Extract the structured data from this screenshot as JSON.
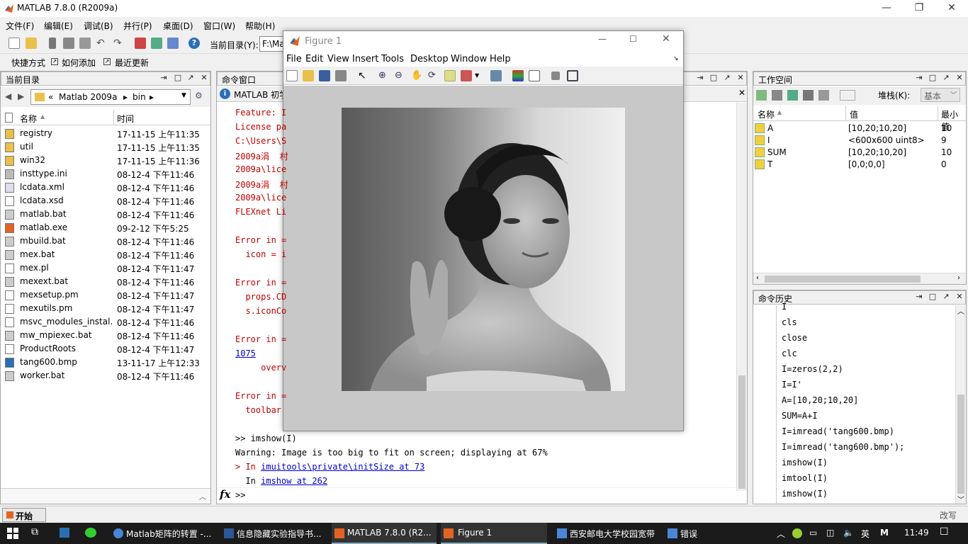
{
  "app": {
    "title": "MATLAB  7.8.0 (R2009a)",
    "menu": [
      "文件(F)",
      "编辑(E)",
      "调试(B)",
      "并行(P)",
      "桌面(D)",
      "窗口(W)",
      "帮助(H)"
    ],
    "current_dir_label": "当前目录(Y):",
    "current_dir_value": "F:\\Ma",
    "shortcuts": [
      "快捷方式",
      "如何添加",
      "最近更新"
    ]
  },
  "current_folder": {
    "title": "当前目录",
    "path_parts": [
      "«",
      "Matlab 2009a",
      "▸",
      "bin",
      "▸"
    ],
    "col_name": "名称",
    "col_time": "时间",
    "files": [
      {
        "name": "registry",
        "time": "17-11-15 上午11:35",
        "type": "folder"
      },
      {
        "name": "util",
        "time": "17-11-15 上午11:35",
        "type": "folder"
      },
      {
        "name": "win32",
        "time": "17-11-15 上午11:36",
        "type": "folder"
      },
      {
        "name": "insttype.ini",
        "time": "08-12-4 下午11:46",
        "type": "ini"
      },
      {
        "name": "lcdata.xml",
        "time": "08-12-4 下午11:46",
        "type": "xml"
      },
      {
        "name": "lcdata.xsd",
        "time": "08-12-4 下午11:46",
        "type": "file"
      },
      {
        "name": "matlab.bat",
        "time": "08-12-4 下午11:46",
        "type": "bat"
      },
      {
        "name": "matlab.exe",
        "time": "09-2-12 下午5:25",
        "type": "exe"
      },
      {
        "name": "mbuild.bat",
        "time": "08-12-4 下午11:46",
        "type": "bat"
      },
      {
        "name": "mex.bat",
        "time": "08-12-4 下午11:46",
        "type": "bat"
      },
      {
        "name": "mex.pl",
        "time": "08-12-4 下午11:47",
        "type": "file"
      },
      {
        "name": "mexext.bat",
        "time": "08-12-4 下午11:46",
        "type": "bat"
      },
      {
        "name": "mexsetup.pm",
        "time": "08-12-4 下午11:47",
        "type": "file"
      },
      {
        "name": "mexutils.pm",
        "time": "08-12-4 下午11:47",
        "type": "file"
      },
      {
        "name": "msvc_modules_instal...",
        "time": "08-12-4 下午11:46",
        "type": "file"
      },
      {
        "name": "mw_mpiexec.bat",
        "time": "08-12-4 下午11:46",
        "type": "bat"
      },
      {
        "name": "ProductRoots",
        "time": "08-12-4 下午11:47",
        "type": "file"
      },
      {
        "name": "tang600.bmp",
        "time": "13-11-17 上午12:33",
        "type": "bmp"
      },
      {
        "name": "worker.bat",
        "time": "08-12-4 下午11:46",
        "type": "bat"
      }
    ]
  },
  "command_window": {
    "title": "命令窗口",
    "info_bar": "MATLAB 初学",
    "lines": [
      {
        "text": "Feature: I",
        "cls": "red"
      },
      {
        "text": "License pa",
        "cls": "red"
      },
      {
        "text": "C:\\Users\\S",
        "cls": "red"
      },
      {
        "text": "2009a涓  村",
        "cls": "red"
      },
      {
        "text": "2009a\\lice",
        "cls": "red"
      },
      {
        "text": "2009a涓  村",
        "cls": "red"
      },
      {
        "text": "2009a\\lice",
        "cls": "red"
      },
      {
        "text": "FLEXnet Li",
        "cls": "red"
      },
      {
        "text": "",
        "cls": ""
      },
      {
        "text": "Error in =",
        "cls": "red"
      },
      {
        "text": "  icon = i",
        "cls": "red"
      },
      {
        "text": "",
        "cls": ""
      },
      {
        "text": "Error in =",
        "cls": "red"
      },
      {
        "text": "  props.CD",
        "cls": "red"
      },
      {
        "text": "  s.iconCo",
        "cls": "red"
      },
      {
        "text": "",
        "cls": ""
      },
      {
        "text": "Error in =",
        "cls": "red"
      },
      {
        "text": "1075",
        "cls": "red link"
      },
      {
        "text": "     overv",
        "cls": "red"
      },
      {
        "text": "",
        "cls": ""
      },
      {
        "text": "Error in =",
        "cls": "red"
      },
      {
        "text": "  toolbar",
        "cls": "red"
      },
      {
        "text": "",
        "cls": ""
      },
      {
        "text": ">> imshow(I)",
        "cls": ""
      },
      {
        "text": "Warning: Image is too big to fit on screen; displaying at 67%",
        "cls": ""
      }
    ],
    "in_prefix_1": "> In ",
    "in_link_1": "imuitools\\private\\initSize at 73",
    "in_prefix_2": "  In ",
    "in_link_2": "imshow at 262",
    "prompt": ">>",
    "fx": "fx"
  },
  "figure": {
    "title": "Figure 1",
    "menu": [
      "File",
      "Edit",
      "View",
      "Insert",
      "Tools",
      "Desktop",
      "Window",
      "Help"
    ]
  },
  "workspace": {
    "title": "工作空间",
    "stack_label": "堆栈(K):",
    "stack_value": "基本",
    "col_name": "名称",
    "col_value": "值",
    "col_min": "最小值",
    "vars": [
      {
        "name": "A",
        "value": "[10,20;10,20]",
        "min": "10"
      },
      {
        "name": "I",
        "value": "<600x600 uint8>",
        "min": "9"
      },
      {
        "name": "SUM",
        "value": "[10,20;10,20]",
        "min": "10"
      },
      {
        "name": "T",
        "value": "[0,0;0,0]",
        "min": "0"
      }
    ]
  },
  "history": {
    "title": "命令历史",
    "items": [
      "I",
      "cls",
      "close",
      "clc",
      "I=zeros(2,2)",
      "I=I'",
      "A=[10,20;10,20]",
      "SUM=A+I",
      "I=imread('tang600.bmp)",
      "I=imread('tang600.bmp');",
      "imshow(I)",
      "imtool(I)",
      "imshow(I)"
    ]
  },
  "statusbar": {
    "start": "开始(S)",
    "mode": "改写"
  },
  "taskbar": {
    "items": [
      "Matlab矩阵的转置 -...",
      "信息隐藏实验指导书...",
      "MATLAB  7.8.0 (R2...",
      "Figure 1",
      "西安邮电大学校园宽带",
      "错误"
    ],
    "ime": "英",
    "time": "11:49"
  }
}
